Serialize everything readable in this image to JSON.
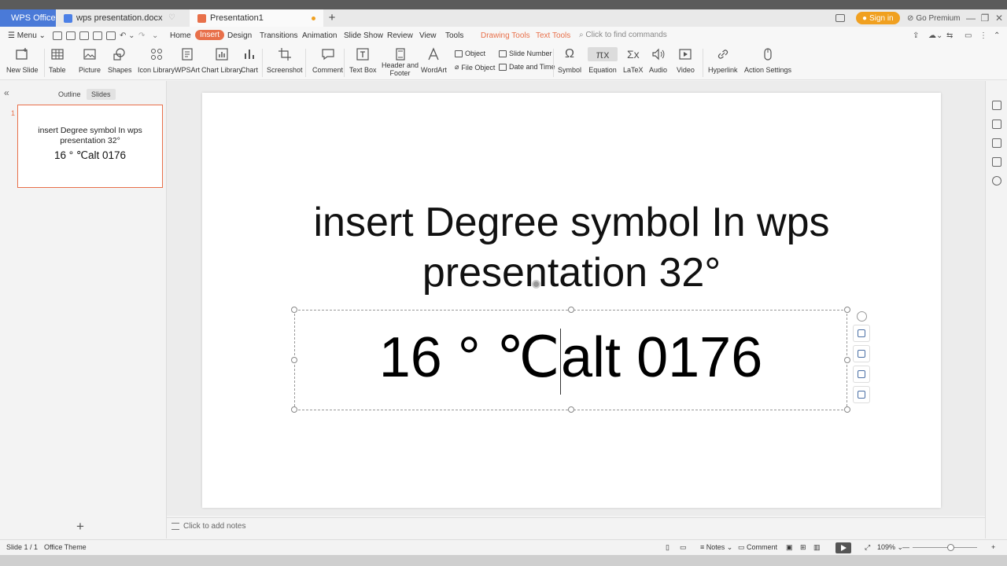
{
  "tabs": {
    "wps": "WPS Office",
    "doc": "wps presentation.docx",
    "ppt": "Presentation1"
  },
  "titlebar": {
    "signin": "Sign in",
    "premium": "Go Premium"
  },
  "menu": {
    "menu_label": "Menu",
    "items": [
      "Home",
      "Insert",
      "Design",
      "Transitions",
      "Animation",
      "Slide Show",
      "Review",
      "View",
      "Tools",
      "Drawing Tools",
      "Text Tools"
    ],
    "find": "Click to find commands"
  },
  "ribbon": {
    "new_slide": "New Slide",
    "table": "Table",
    "picture": "Picture",
    "shapes": "Shapes",
    "icon_library": "Icon Library",
    "wpsart": "WPSArt",
    "chart_library": "Chart Library",
    "chart": "Chart",
    "screenshot": "Screenshot",
    "comment": "Comment",
    "text_box": "Text Box",
    "header_footer_1": "Header and",
    "header_footer_2": "Footer",
    "wordart": "WordArt",
    "object": "Object",
    "file_object": "File Object",
    "slide_number": "Slide Number",
    "date_time": "Date and Time",
    "symbol": "Symbol",
    "equation": "Equation",
    "latex": "LaTeX",
    "audio": "Audio",
    "video": "Video",
    "hyperlink": "Hyperlink",
    "action_settings": "Action Settings"
  },
  "panel": {
    "outline": "Outline",
    "slides": "Slides",
    "slide_number": "1",
    "thumb_title_1": "insert  Degree symbol In wps",
    "thumb_title_2": "presentation 32°",
    "thumb_body": "16 ° ℃alt 0176"
  },
  "slide": {
    "title_line1": "insert  Degree symbol In wps",
    "title_line2": "presentation 32°",
    "body_before": "16 ° ℃",
    "body_after": "alt 0176"
  },
  "notes": {
    "placeholder": "Click to add notes"
  },
  "status": {
    "slide_count": "Slide 1 / 1",
    "theme": "Office Theme",
    "notes": "Notes",
    "comment": "Comment",
    "zoom": "109%"
  }
}
